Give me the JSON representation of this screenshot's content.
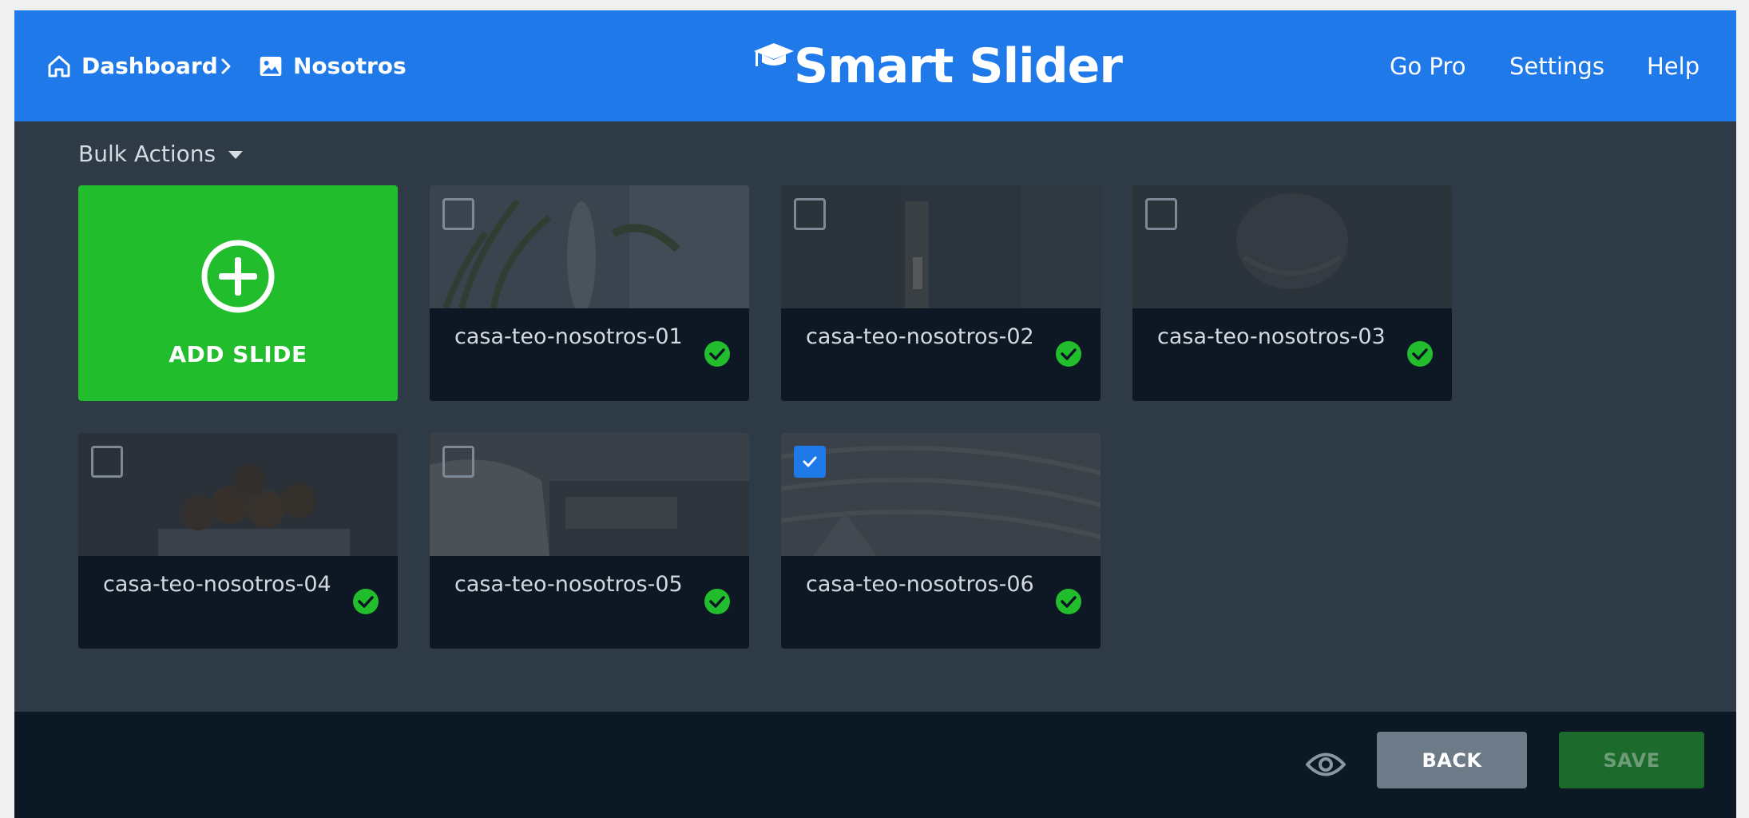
{
  "breadcrumb": {
    "dashboard_label": "Dashboard",
    "slider_label": "Nosotros"
  },
  "logo": {
    "text": "Smart Slider"
  },
  "nav": {
    "gopro": "Go Pro",
    "settings": "Settings",
    "help": "Help"
  },
  "bulk_actions": {
    "label": "Bulk Actions"
  },
  "add_slide": {
    "label": "ADD SLIDE"
  },
  "slides": [
    {
      "name": "casa-teo-nosotros-01",
      "checked": false,
      "published": true
    },
    {
      "name": "casa-teo-nosotros-02",
      "checked": false,
      "published": true
    },
    {
      "name": "casa-teo-nosotros-03",
      "checked": false,
      "published": true
    },
    {
      "name": "casa-teo-nosotros-04",
      "checked": false,
      "published": true
    },
    {
      "name": "casa-teo-nosotros-05",
      "checked": false,
      "published": true
    },
    {
      "name": "casa-teo-nosotros-06",
      "checked": true,
      "published": true
    }
  ],
  "footer": {
    "back_label": "BACK",
    "save_label": "SAVE"
  },
  "icons": {
    "dashboard": "home-icon",
    "separator": "chevron-right-icon",
    "slider": "image-icon",
    "logo_cap": "graduation-cap-icon",
    "bulk_caret": "caret-down-icon",
    "add": "plus-circle-icon",
    "status": "check-circle-icon",
    "preview": "eye-icon"
  },
  "colors": {
    "header": "#1f79e8",
    "content_bg": "#2e3a46",
    "footer_bg": "#0c1824",
    "add_slide": "#22bd2d",
    "published": "#22bd2d",
    "back_button": "#6d7b89",
    "save_button": "#1c6b2d"
  }
}
